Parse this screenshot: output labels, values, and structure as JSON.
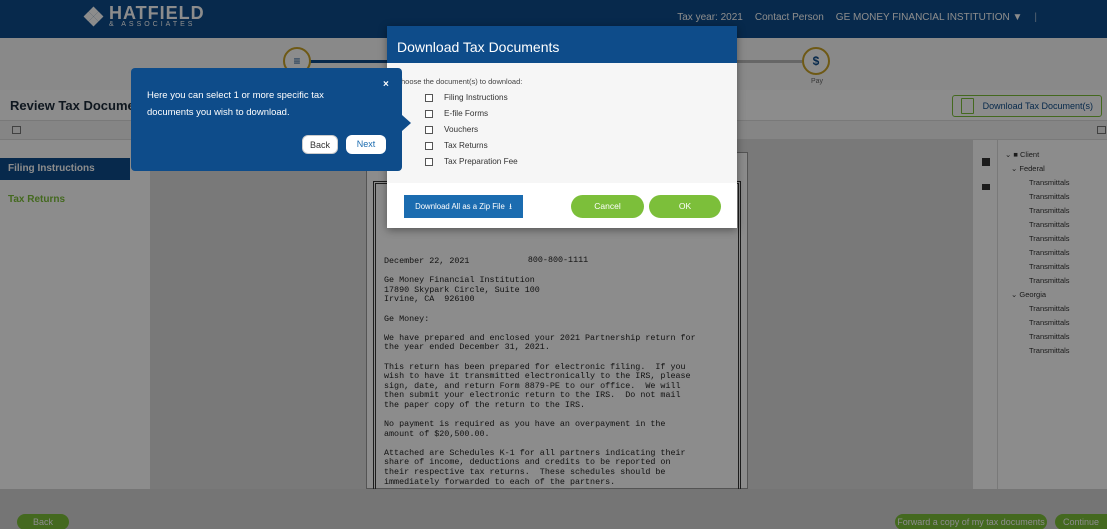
{
  "brand": {
    "title": "HATFIELD",
    "subtitle": "& ASSOCIATES"
  },
  "topnav": {
    "tax_year": "Tax year: 2021",
    "contact": "Contact Person",
    "institution": "GE MONEY FINANCIAL INSTITUTION ▼"
  },
  "steps": {
    "pay_label": "Pay"
  },
  "page": {
    "title": "Review Tax Documents",
    "download_btn": "Download Tax Document(s)"
  },
  "sidebar": {
    "items": [
      {
        "label": "Filing Instructions"
      },
      {
        "label": "Tax Returns"
      }
    ]
  },
  "document": {
    "phone": "800-800-1111",
    "body": "December 22, 2021\n\nGe Money Financial Institution\n17890 Skypark Circle, Suite 100\nIrvine, CA  926100\n\nGe Money:\n\nWe have prepared and enclosed your 2021 Partnership return for\nthe year ended December 31, 2021.\n\nThis return has been prepared for electronic filing.  If you\nwish to have it transmitted electronically to the IRS, please\nsign, date, and return Form 8879-PE to our office.  We will\nthen submit your electronic return to the IRS.  Do not mail\nthe paper copy of the return to the IRS.\n\nNo payment is required as you have an overpayment in the\namount of $20,500.00.\n\nAttached are Schedules K-1 for all partners indicating their\nshare of income, deductions and credits to be reported on\ntheir respective tax returns.  These schedules should be\nimmediately forwarded to each of the partners."
  },
  "tree": {
    "client": "Client",
    "federal": "Federal",
    "georgia": "Georgia",
    "federal_items": [
      "Transmittals",
      "Transmittals",
      "Transmittals",
      "Transmittals",
      "Transmittals",
      "Transmittals",
      "Transmittals",
      "Transmittals"
    ],
    "georgia_items": [
      "Transmittals",
      "Transmittals",
      "Transmittals",
      "Transmittals"
    ]
  },
  "footer": {
    "back": "Back",
    "forward": "Forward a copy of my tax documents",
    "continue": "Continue"
  },
  "modal": {
    "title": "Download Tax Documents",
    "prompt": "hoose the document(s) to download:",
    "options": [
      "Filing Instructions",
      "E-file Forms",
      "Vouchers",
      "Tax Returns",
      "Tax Preparation Fee"
    ],
    "zip_button": "Download All as a Zip File",
    "cancel": "Cancel",
    "ok": "OK"
  },
  "coachmark": {
    "text": "Here you can select 1 or more specific tax documents you wish to download.",
    "close": "×",
    "back": "Back",
    "next": "Next"
  },
  "colors": {
    "primary": "#0e4c8a",
    "accent": "#7cbf3a",
    "button_blue": "#1b6cb0"
  }
}
